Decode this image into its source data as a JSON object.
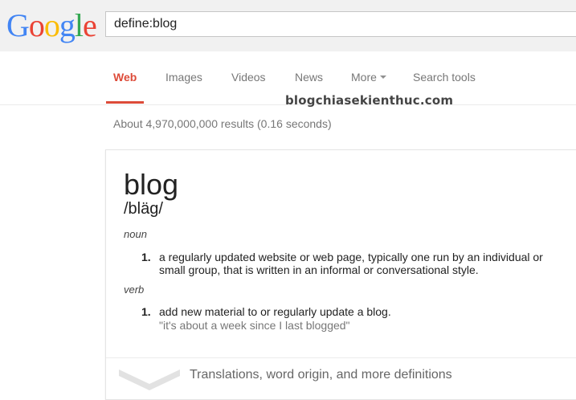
{
  "header": {
    "logo": {
      "letters": [
        {
          "ch": "G",
          "color": "#4285f4"
        },
        {
          "ch": "o",
          "color": "#ea4335"
        },
        {
          "ch": "o",
          "color": "#fbbc05"
        },
        {
          "ch": "g",
          "color": "#4285f4"
        },
        {
          "ch": "l",
          "color": "#34a853"
        },
        {
          "ch": "e",
          "color": "#ea4335"
        }
      ]
    },
    "search_query": "define:blog"
  },
  "tabs": {
    "web": "Web",
    "images": "Images",
    "videos": "Videos",
    "news": "News",
    "more": "More",
    "search_tools": "Search tools"
  },
  "watermark": "blogchiasekienthuc.com",
  "results_stats": "About 4,970,000,000 results (0.16 seconds)",
  "definition": {
    "word": "blog",
    "phonetic": "/bläg/",
    "noun": {
      "pos": "noun",
      "number": "1.",
      "line1": "a regularly updated website or web page, typically one run by an individual or",
      "line2": "small group, that is written in an informal or conversational style."
    },
    "verb": {
      "pos": "verb",
      "number": "1.",
      "text": "add new material to or regularly update a blog.",
      "example": "\"it's about a week since I last blogged\""
    },
    "more_link": "Translations, word origin, and more definitions"
  },
  "colors": {
    "accent": "#dd4b39"
  }
}
